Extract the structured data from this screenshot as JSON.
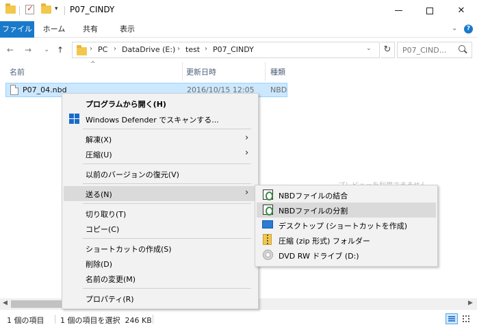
{
  "window": {
    "title": "P07_CINDY",
    "minimize_glyph": "—",
    "close_glyph": "✕"
  },
  "ribbon": {
    "tabs": [
      "ファイル",
      "ホーム",
      "共有",
      "表示"
    ],
    "collapse_glyph": "⌄",
    "help_glyph": "?"
  },
  "nav": {
    "back": "←",
    "forward": "→",
    "recent": "⌄",
    "up": "↑",
    "breadcrumbs": [
      "PC",
      "DataDrive (E:)",
      "test",
      "P07_CINDY"
    ],
    "breadcrumb_sep": "›",
    "search_placeholder": "P07_CIND..."
  },
  "columns": {
    "name": "名前",
    "date": "更新日時",
    "type": "種類",
    "sort_glyph": "^"
  },
  "file": {
    "name": "P07_04.nbd",
    "date": "2016/10/15 12:05",
    "type": "NBD"
  },
  "background_hint": "プレビューを利用できません",
  "context_menu": {
    "items": [
      {
        "label": "プログラムから開く(H)",
        "bold": true
      },
      {
        "label": "Windows Defender でスキャンする...",
        "icon": "windows-defender-icon"
      },
      {
        "label": "解凍(X)",
        "submenu": true
      },
      {
        "label": "圧縮(U)",
        "submenu": true
      },
      {
        "label": "以前のバージョンの復元(V)"
      },
      {
        "label": "送る(N)",
        "submenu": true,
        "highlighted": true
      },
      {
        "label": "切り取り(T)"
      },
      {
        "label": "コピー(C)"
      },
      {
        "label": "ショートカットの作成(S)"
      },
      {
        "label": "削除(D)"
      },
      {
        "label": "名前の変更(M)"
      },
      {
        "label": "プロパティ(R)"
      }
    ],
    "chevron_glyph": "›"
  },
  "send_to_menu": {
    "items": [
      {
        "label": "NBDファイルの結合",
        "icon": "nbd-join-icon"
      },
      {
        "label": "NBDファイルの分割",
        "icon": "nbd-split-icon",
        "highlighted": true
      },
      {
        "label": "デスクトップ (ショートカットを作成)",
        "icon": "desktop-icon"
      },
      {
        "label": "圧縮 (zip 形式) フォルダー",
        "icon": "zip-folder-icon"
      },
      {
        "label": "DVD RW ドライブ (D:)",
        "icon": "dvd-drive-icon"
      }
    ]
  },
  "status": {
    "item_count": "1 個の項目",
    "selection": "1 個の項目を選択  246 KB"
  },
  "scrollbar": {
    "left_glyph": "◀",
    "right_glyph": "▶"
  }
}
